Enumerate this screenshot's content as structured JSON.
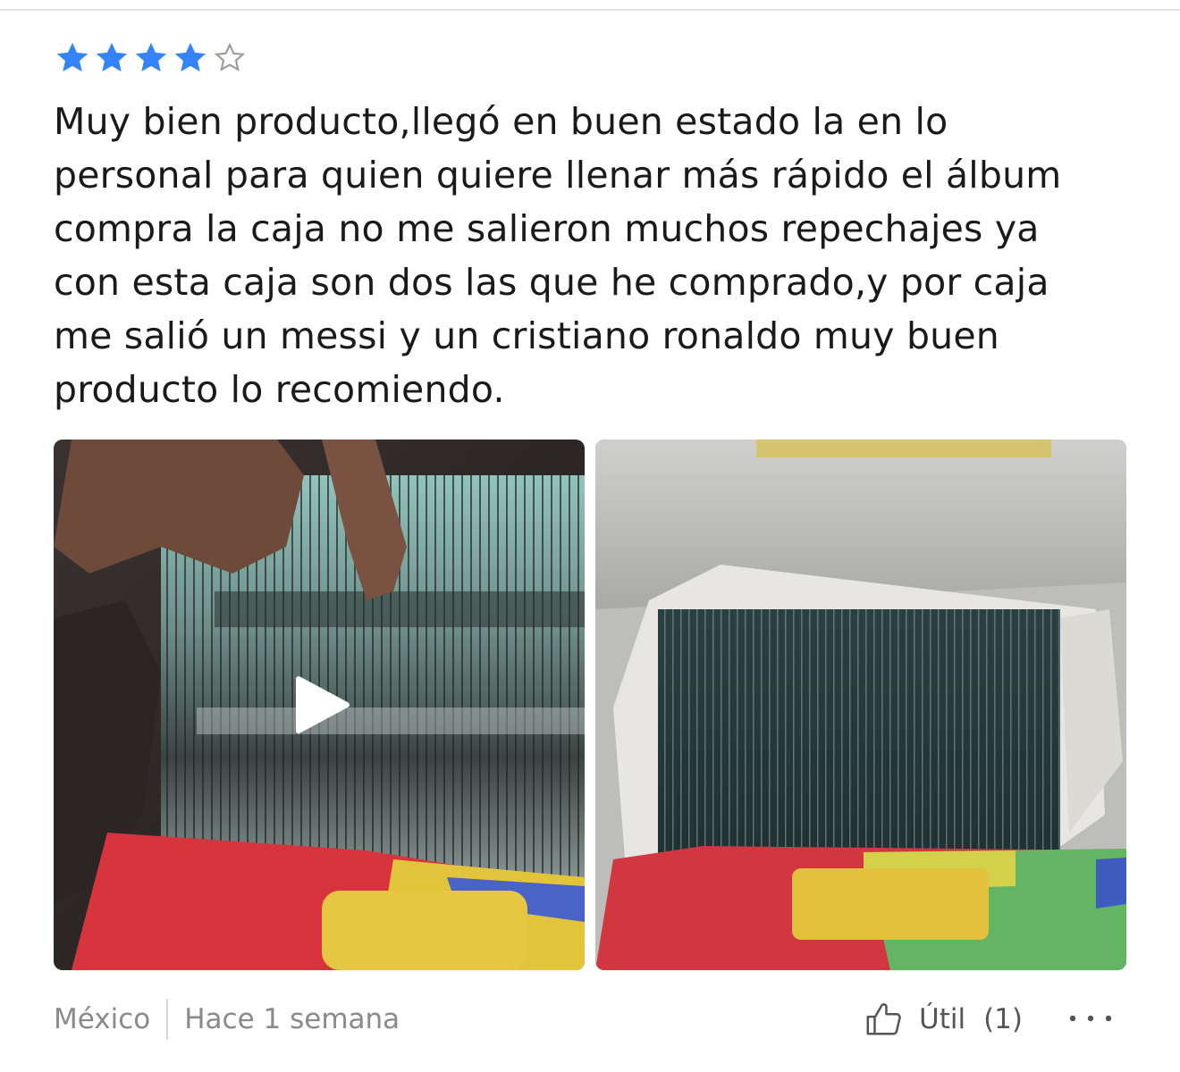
{
  "review": {
    "rating": 4,
    "max_rating": 5,
    "star_color": "#3483fa",
    "star_empty_color": "#9a9a9a",
    "text": "Muy bien producto,llegó en buen estado la en lo personal para quien quiere llenar más rápido el álbum compra la caja no me salieron muchos repechajes ya con esta caja son dos las que he comprado,y por caja me salió un messi y un cristiano ronaldo muy buen producto lo recomiendo."
  },
  "media": [
    {
      "kind": "video",
      "icon": "play-icon"
    },
    {
      "kind": "photo"
    }
  ],
  "footer": {
    "country": "México",
    "date": "Hace 1 semana",
    "helpful_label": "Útil",
    "helpful_count": "(1)",
    "more_icon": "more-options-icon"
  }
}
